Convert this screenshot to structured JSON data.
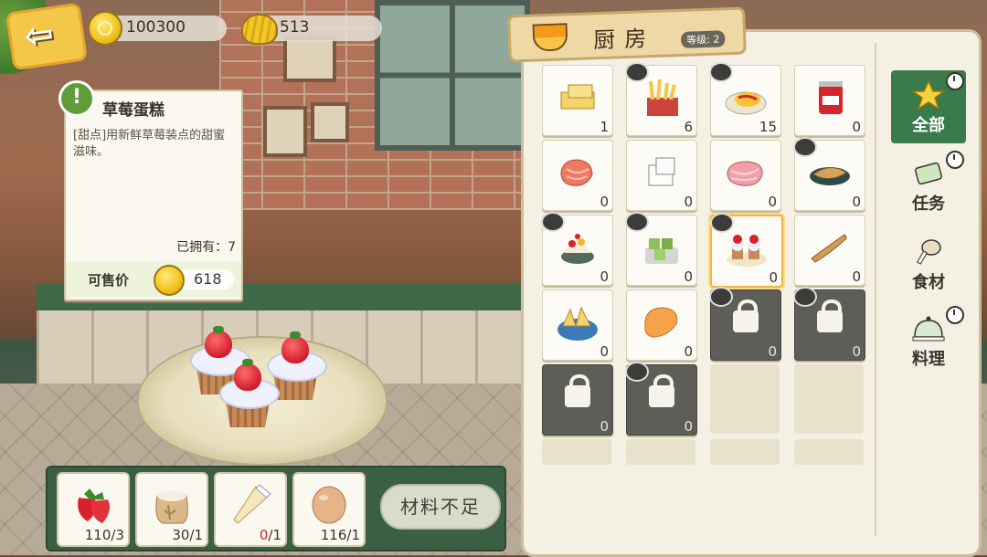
{
  "currencies": {
    "gold": "100300",
    "shells": "513"
  },
  "item_info": {
    "icon": "exclamation-icon",
    "title": "草莓蛋糕",
    "description": "[甜点]用新鲜草莓装点的甜蜜滋味。",
    "owned_label": "已拥有：",
    "owned_value": "7",
    "price_label": "可售价",
    "price_value": "618"
  },
  "ingredients": [
    {
      "name": "strawberry",
      "count": "110/3",
      "insufficient": false
    },
    {
      "name": "flour-sack",
      "count": "30/1",
      "insufficient": false
    },
    {
      "name": "cream-piping-bag",
      "have": "0",
      "need": "/1",
      "insufficient": true
    },
    {
      "name": "egg",
      "count": "116/1",
      "insufficient": false
    }
  ],
  "craft_button": "材料不足",
  "kitchen": {
    "title": "厨房",
    "level": "等级: 2"
  },
  "inventory": [
    {
      "name": "butter",
      "count": "1",
      "state": "normal",
      "cooking": false
    },
    {
      "name": "fries",
      "count": "6",
      "state": "normal",
      "cooking": true
    },
    {
      "name": "omelette-rice",
      "count": "15",
      "state": "normal",
      "cooking": true
    },
    {
      "name": "jam-jar",
      "count": "0",
      "state": "normal",
      "cooking": false
    },
    {
      "name": "salmon-steak",
      "count": "0",
      "state": "normal",
      "cooking": false
    },
    {
      "name": "tofu",
      "count": "0",
      "state": "normal",
      "cooking": false
    },
    {
      "name": "raw-meat",
      "count": "0",
      "state": "normal",
      "cooking": false
    },
    {
      "name": "grilled-fish",
      "count": "0",
      "state": "normal",
      "cooking": true
    },
    {
      "name": "fruit-shaved-ice",
      "count": "0",
      "state": "normal",
      "cooking": true
    },
    {
      "name": "green-rice-cakes",
      "count": "0",
      "state": "normal",
      "cooking": true
    },
    {
      "name": "strawberry-cake",
      "count": "0",
      "state": "selected",
      "cooking": true
    },
    {
      "name": "dried-fish",
      "count": "0",
      "state": "normal",
      "cooking": false
    },
    {
      "name": "sliced-fruit-bowl",
      "count": "0",
      "state": "normal",
      "cooking": false
    },
    {
      "name": "orange-slice",
      "count": "0",
      "state": "normal",
      "cooking": false
    },
    {
      "name": "locked-dish",
      "count": "0",
      "state": "locked",
      "cooking": true
    },
    {
      "name": "locked-dish",
      "count": "0",
      "state": "locked",
      "cooking": true
    },
    {
      "name": "locked-dish",
      "count": "0",
      "state": "locked",
      "cooking": false
    },
    {
      "name": "locked-dish",
      "count": "0",
      "state": "locked",
      "cooking": true
    }
  ],
  "tabs": [
    {
      "label": "全部",
      "icon": "star-icon",
      "active": true
    },
    {
      "label": "任务",
      "icon": "scroll-icon",
      "active": false
    },
    {
      "label": "食材",
      "icon": "drumstick-icon",
      "active": false
    },
    {
      "label": "料理",
      "icon": "cloche-icon",
      "active": false
    }
  ],
  "colors": {
    "accent_green": "#3b7a4a",
    "gold": "#f1c21b",
    "insufficient_red": "#d22a2a"
  }
}
